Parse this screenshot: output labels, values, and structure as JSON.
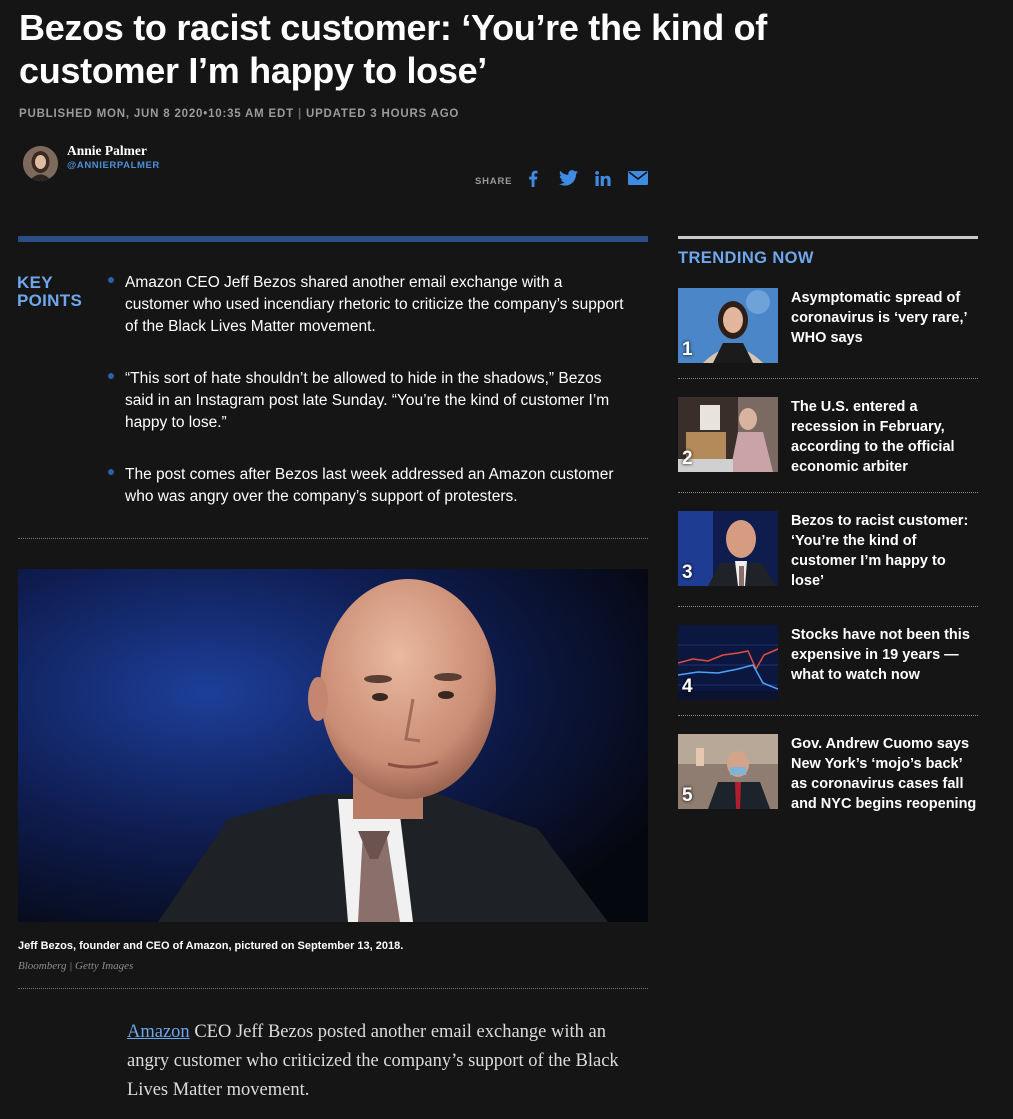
{
  "article": {
    "headline": "Bezos to racist customer: ‘You’re the kind of customer I’m happy to lose’",
    "published": "PUBLISHED MON, JUN 8 2020•10:35 AM EDT",
    "updated": "UPDATED 3 HOURS AGO",
    "author": {
      "name": "Annie Palmer",
      "handle": "@ANNIERPALMER"
    },
    "share_label": "SHARE"
  },
  "share_icons": [
    "facebook-icon",
    "twitter-icon",
    "linkedin-icon",
    "email-icon"
  ],
  "key_points": {
    "title": "KEY POINTS",
    "items": [
      "Amazon CEO Jeff Bezos shared another email exchange with a customer who used incendiary rhetoric to criticize the company’s support of the Black Lives Matter movement.",
      "“This sort of hate shouldn’t be allowed to hide in the shadows,” Bezos said in an Instagram post late Sunday. “You’re the kind of customer I’m happy to lose.”",
      "The post comes after Bezos last week addressed an Amazon customer who was angry over the company’s support of protesters."
    ]
  },
  "photo": {
    "caption": "Jeff Bezos, founder and CEO of Amazon, pictured on September 13, 2018.",
    "credit": "Bloomberg | Getty Images"
  },
  "body": {
    "link_text": "Amazon",
    "text": " CEO Jeff Bezos posted another email exchange with an angry customer who criticized the company’s support of the Black Lives Matter movement."
  },
  "trending": {
    "title": "TRENDING NOW",
    "items": [
      {
        "num": "1",
        "text": "Asymptomatic spread of coronavirus is ‘very rare,’ WHO says"
      },
      {
        "num": "2",
        "text": "The U.S. entered a recession in February, according to the official economic arbiter"
      },
      {
        "num": "3",
        "text": "Bezos to racist customer: ‘You’re the kind of customer I’m happy to lose’"
      },
      {
        "num": "4",
        "text": "Stocks have not been this expensive in 19 years — what to watch now"
      },
      {
        "num": "5",
        "text": "Gov. Andrew Cuomo says New York’s ‘mojo’s back’ as coronavirus cases fall and NYC begins reopening"
      }
    ]
  },
  "colors": {
    "accent_blue": "#6ea7ec",
    "link_blue": "#3d8be3",
    "rule_blue": "#2a4f87",
    "background": "#151515"
  }
}
